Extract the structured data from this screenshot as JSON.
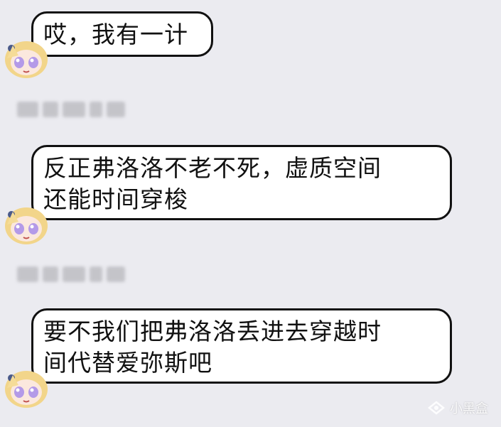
{
  "messages": [
    {
      "lines": [
        "哎，我有一计"
      ]
    },
    {
      "lines": [
        "反正弗洛洛不老不死，虚质空间",
        "还能时间穿梭"
      ]
    },
    {
      "lines": [
        "要不我们把弗洛洛丢进去穿越时",
        "间代替爱弥斯吧"
      ]
    }
  ],
  "watermark": {
    "text": "小黑盒",
    "icon": "heybox-logo-icon"
  },
  "colors": {
    "background": "#ebebf0",
    "bubble": "#ffffff",
    "bubble_border": "#111111",
    "avatar_hair": "#f2d58a",
    "avatar_eyes": "#b49ae8"
  }
}
